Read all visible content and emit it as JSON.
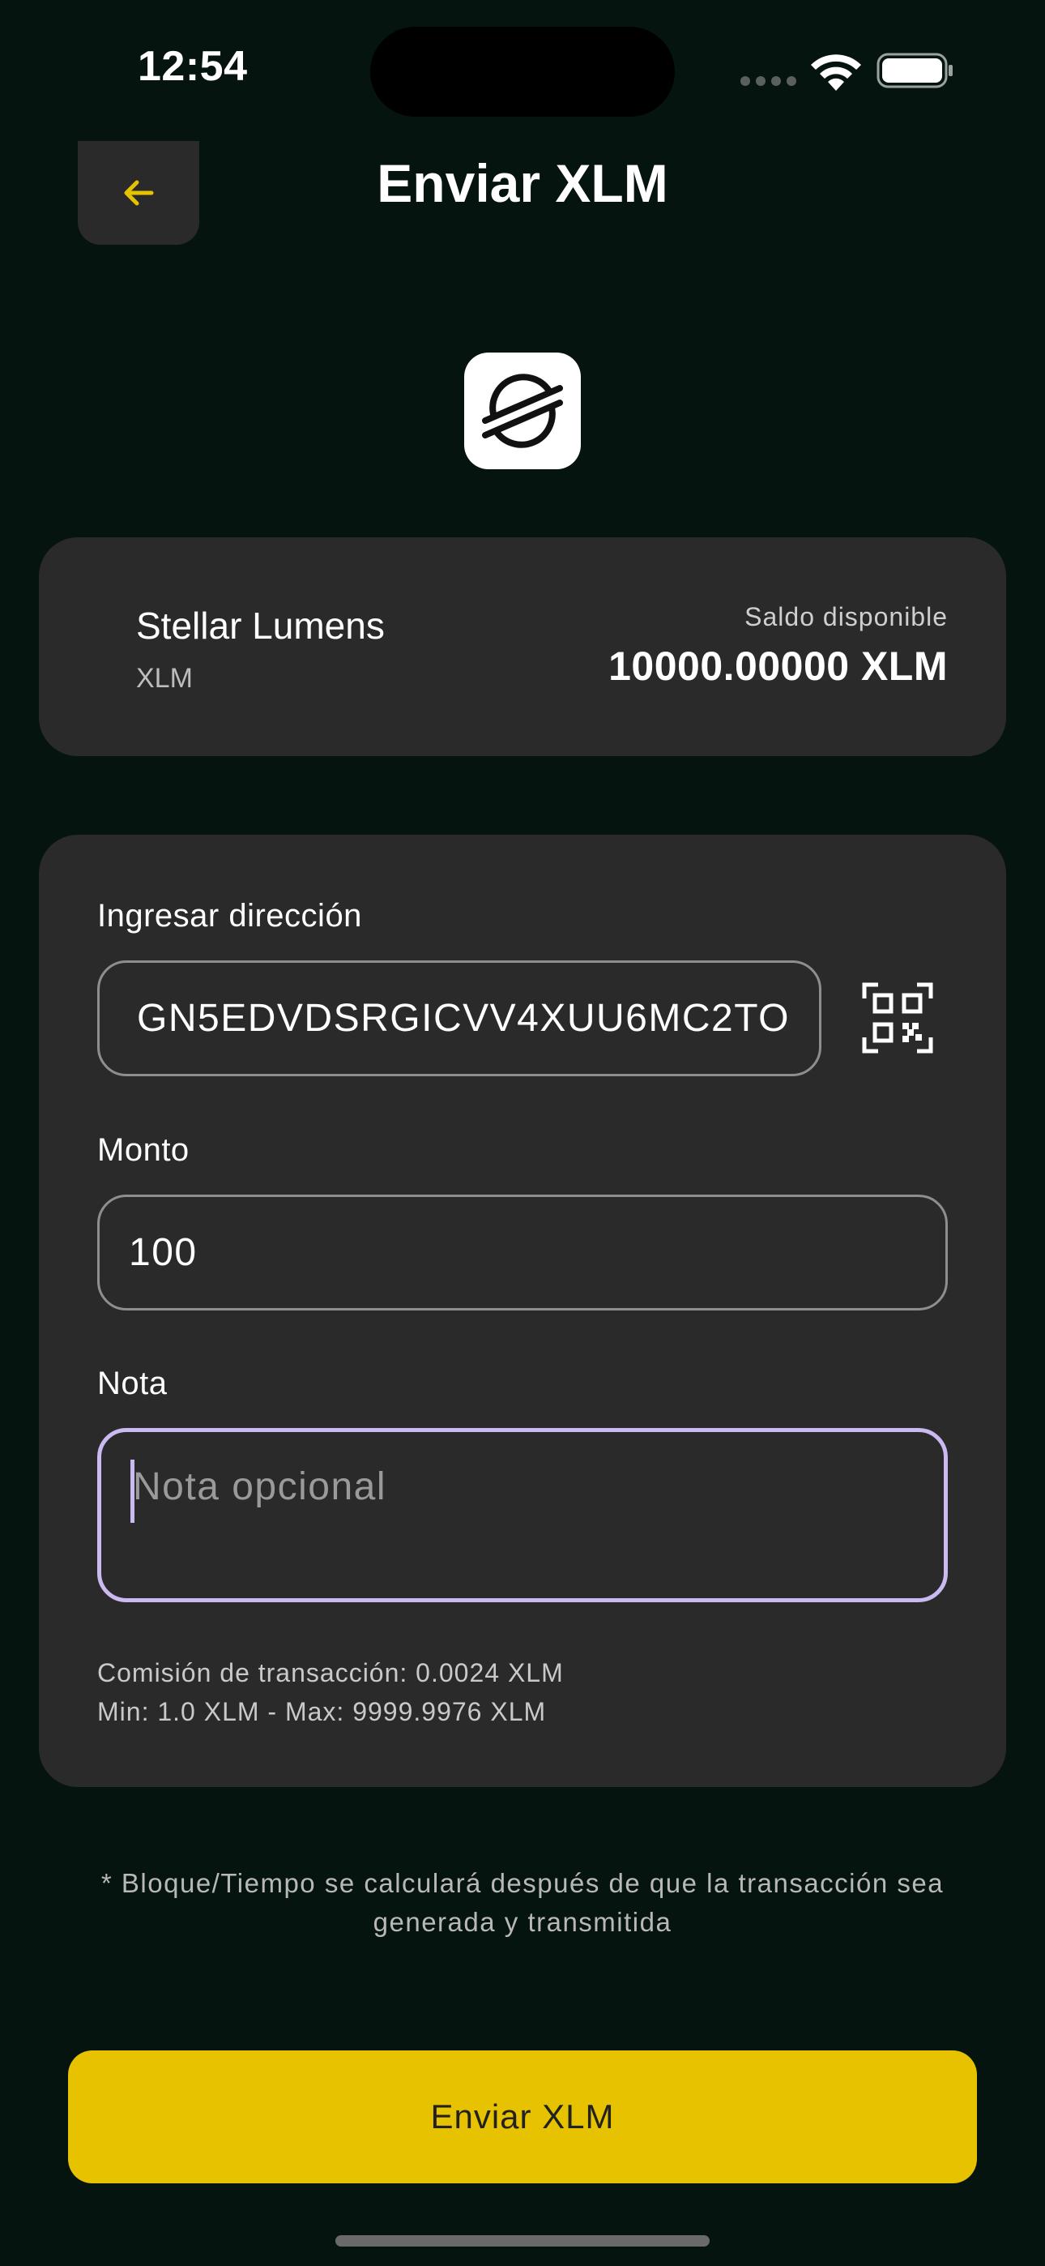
{
  "status_bar": {
    "time": "12:54"
  },
  "header": {
    "title": "Enviar XLM",
    "back_icon": "arrow-left-icon",
    "accent_color": "#E6C200"
  },
  "asset": {
    "logo_icon": "stellar-logo-icon",
    "name": "Stellar Lumens",
    "ticker": "XLM",
    "balance_label": "Saldo disponible",
    "balance_value": "10000.00000 XLM"
  },
  "form": {
    "address_label": "Ingresar dirección",
    "address_value": "GN5EDVDSRGICVV4XUU6MC2TO",
    "qr_icon": "qr-scan-icon",
    "amount_label": "Monto",
    "amount_value": "100",
    "note_label": "Nota",
    "note_placeholder": "Nota opcional",
    "note_value": "",
    "fee_line": "Comisión de transacción: 0.0024 XLM",
    "limits_line": "Min: 1.0 XLM - Max: 9999.9976 XLM",
    "focus_color": "#CBB9F2"
  },
  "footnote": {
    "line1": "* Bloque/Tiempo se calculará después de que la transacción sea",
    "line2": "generada y transmitida"
  },
  "send_button": {
    "label": "Enviar XLM",
    "color": "#E6C200"
  }
}
